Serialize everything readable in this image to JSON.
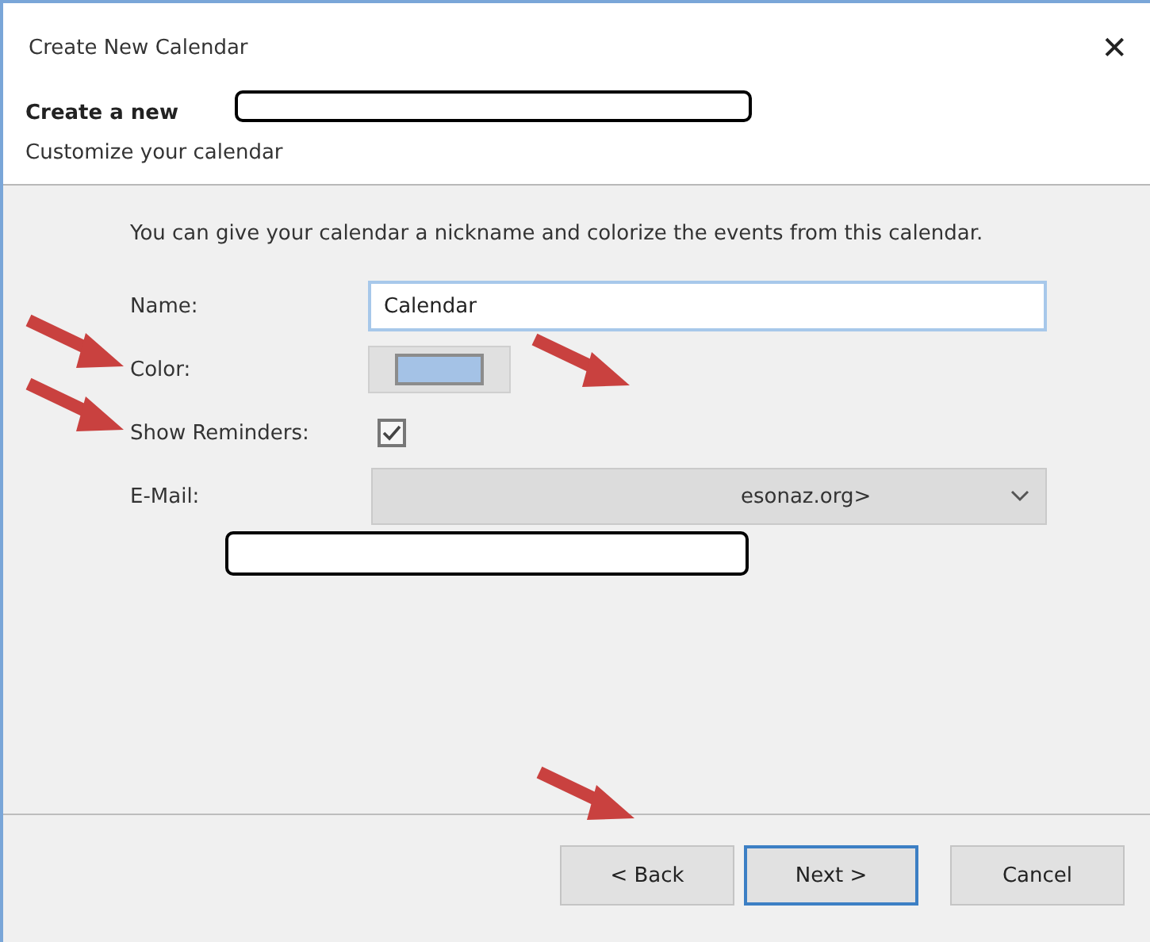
{
  "window": {
    "title": "Create New Calendar",
    "close": "✕"
  },
  "header": {
    "title": "Create a new",
    "subtitle": "Customize your calendar"
  },
  "intro": "You can give your calendar a nickname and colorize the events from this calendar.",
  "form": {
    "name": {
      "label": "Name:",
      "value": "Calendar"
    },
    "color": {
      "label": "Color:",
      "color": "#a4c2e6"
    },
    "reminders": {
      "label": "Show Reminders:",
      "checked": true
    },
    "email": {
      "label": "E-Mail:",
      "value": "esonaz.org>"
    }
  },
  "buttons": [
    {
      "label": "< Back",
      "kind": "normal"
    },
    {
      "label": "Next >",
      "kind": "default"
    },
    {
      "label": "Cancel",
      "kind": "cancel"
    }
  ]
}
